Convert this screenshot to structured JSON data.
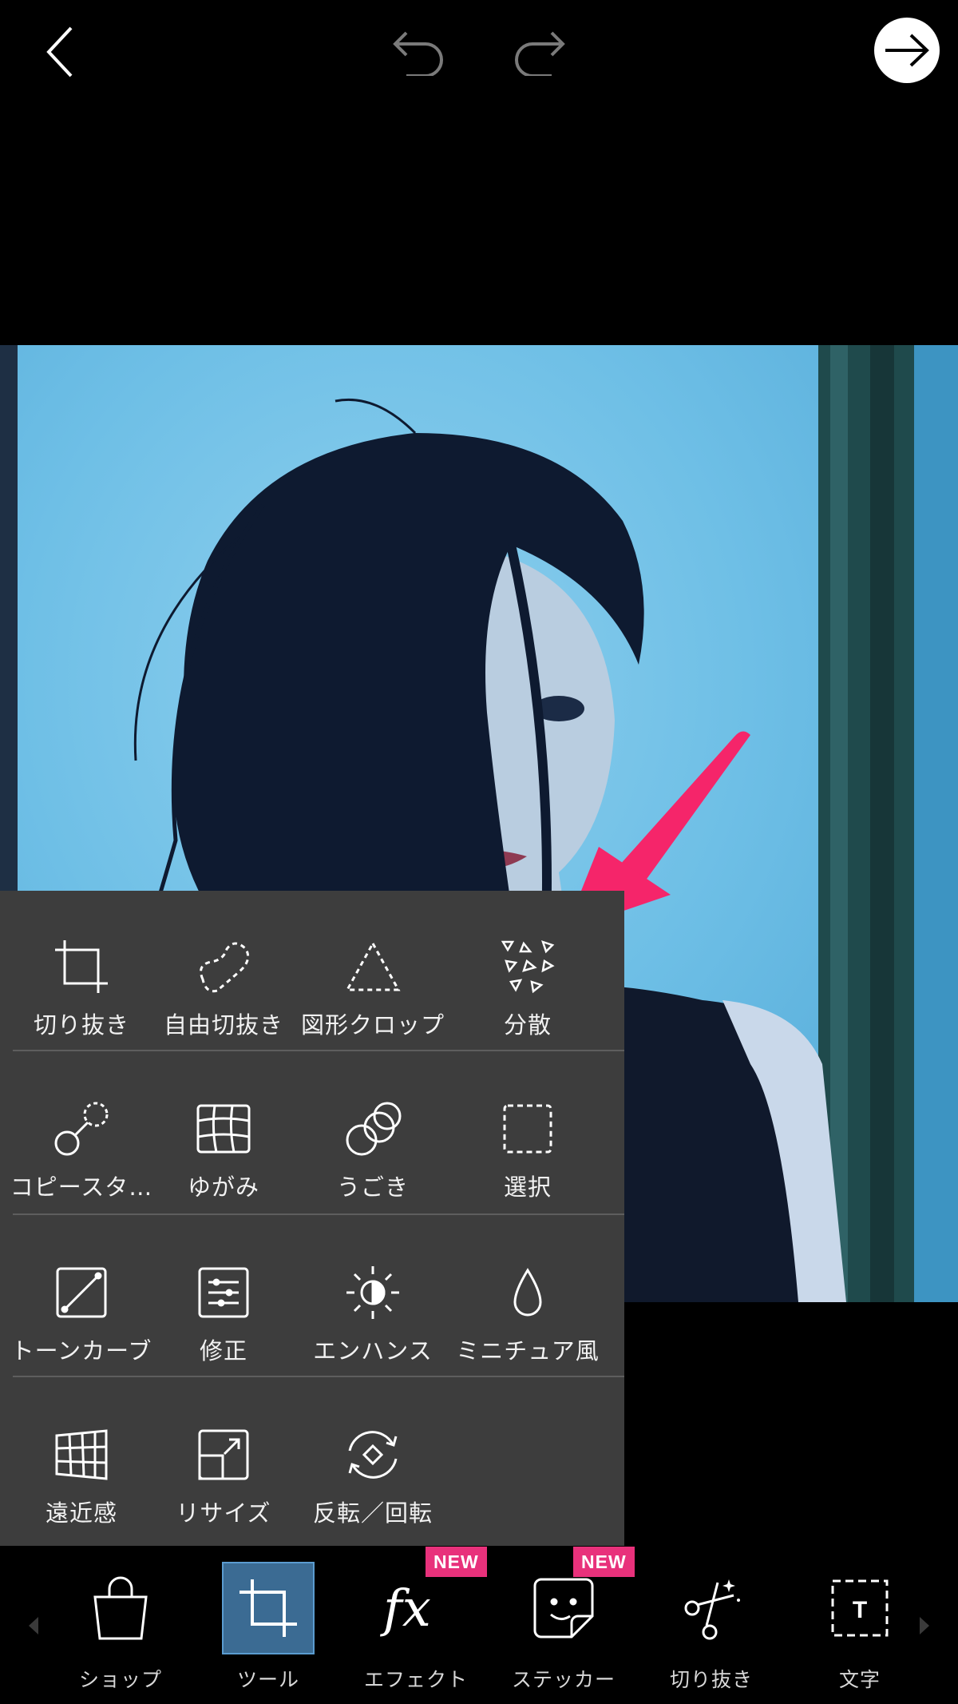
{
  "header": {
    "back_icon": "chevron-left-icon",
    "undo_icon": "undo-icon",
    "redo_icon": "redo-icon",
    "next_icon": "arrow-right-icon"
  },
  "tools": {
    "rows": [
      [
        {
          "label": "切り抜き",
          "icon": "crop-icon"
        },
        {
          "label": "自由切抜き",
          "icon": "free-crop-icon"
        },
        {
          "label": "図形クロップ",
          "icon": "shape-crop-icon"
        },
        {
          "label": "分散",
          "icon": "dispersion-icon"
        }
      ],
      [
        {
          "label": "コピースタ…",
          "icon": "clone-stamp-icon"
        },
        {
          "label": "ゆがみ",
          "icon": "warp-icon"
        },
        {
          "label": "うごき",
          "icon": "motion-icon"
        },
        {
          "label": "選択",
          "icon": "select-icon"
        }
      ],
      [
        {
          "label": "トーンカーブ",
          "icon": "tone-curve-icon"
        },
        {
          "label": "修正",
          "icon": "adjust-icon"
        },
        {
          "label": "エンハンス",
          "icon": "enhance-icon"
        },
        {
          "label": "ミニチュア風",
          "icon": "tilt-shift-icon"
        }
      ],
      [
        {
          "label": "遠近感",
          "icon": "perspective-icon"
        },
        {
          "label": "リサイズ",
          "icon": "resize-icon"
        },
        {
          "label": "反転／回転",
          "icon": "flip-rotate-icon"
        }
      ]
    ]
  },
  "bottom_bar": {
    "items": [
      {
        "label": "ショップ",
        "icon": "shopping-bag-icon"
      },
      {
        "label": "ツール",
        "icon": "crop-tool-icon",
        "active": true
      },
      {
        "label": "エフェクト",
        "icon": "fx-icon",
        "badge": "NEW"
      },
      {
        "label": "ステッカー",
        "icon": "sticker-icon",
        "badge": "NEW"
      },
      {
        "label": "切り抜き",
        "icon": "cutout-scissors-icon"
      },
      {
        "label": "文字",
        "icon": "text-icon"
      }
    ]
  },
  "colors": {
    "panel": "#3d3d3d",
    "active_tab": "#3b6b93",
    "badge": "#e8317b",
    "annotation_arrow": "#f5256a"
  }
}
